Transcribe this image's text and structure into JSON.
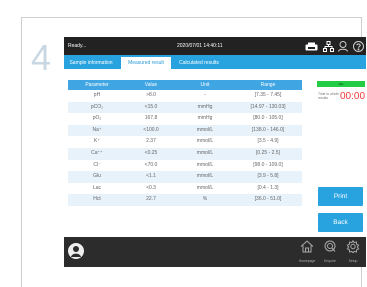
{
  "step_number": "4",
  "topbar": {
    "status": "Ready...",
    "datetime": "2020/07/01 14:40:11"
  },
  "tabs": [
    {
      "label": "Sample information",
      "active": false
    },
    {
      "label": "Measured result",
      "active": true
    },
    {
      "label": "Calculated results",
      "active": false
    }
  ],
  "table": {
    "headers": [
      "Parameter",
      "Value",
      "Unit",
      "Range"
    ],
    "rows": [
      {
        "param": "pH",
        "value": ">8.0",
        "unit": "-",
        "range": "[7.35 - 7.45]"
      },
      {
        "param": "pCO₂",
        "value": "<15.0",
        "unit": "mmHg",
        "range": "[14.97 - 130.03]"
      },
      {
        "param": "pO₂",
        "value": "167.8",
        "unit": "mmHg",
        "range": "[80.0 - 105.0]"
      },
      {
        "param": "Na⁺",
        "value": "<100.0",
        "unit": "mmol/L",
        "range": "[138.0 - 146.0]"
      },
      {
        "param": "K⁺",
        "value": "2.37",
        "unit": "mmol/L",
        "range": "[3.5 - 4.9]"
      },
      {
        "param": "Ca⁺⁺",
        "value": "<0.25",
        "unit": "mmol/L",
        "range": "[0.25 - 2.5]"
      },
      {
        "param": "Cl⁻",
        "value": "<70.0",
        "unit": "mmol/L",
        "range": "[98.0 - 109.0]"
      },
      {
        "param": "Glu",
        "value": "<1.1",
        "unit": "mmol/L",
        "range": "[3.9 - 5.8]"
      },
      {
        "param": "Lac",
        "value": "<0.3",
        "unit": "mmol/L",
        "range": "[0.4 - 1.3]"
      },
      {
        "param": "Hct",
        "value": "22.7",
        "unit": "%",
        "range": "[36.0 - 51.0]"
      }
    ]
  },
  "side": {
    "status_label": "Idle",
    "time_label": "Time to whole results",
    "time_value": "00:00",
    "print_label": "Print",
    "back_label": "Back"
  },
  "bottom": {
    "home": "Homepage",
    "search": "Enquire",
    "settings": "Setup"
  },
  "colors": {
    "accent": "#29a3e0",
    "status_green": "#22cc44",
    "timer_red": "#ee3a3a",
    "bar_dark": "#222222"
  },
  "icons": [
    "printer-icon",
    "network-icon",
    "user-icon",
    "help-icon",
    "avatar-icon",
    "home-icon",
    "search-icon",
    "settings-icon"
  ]
}
